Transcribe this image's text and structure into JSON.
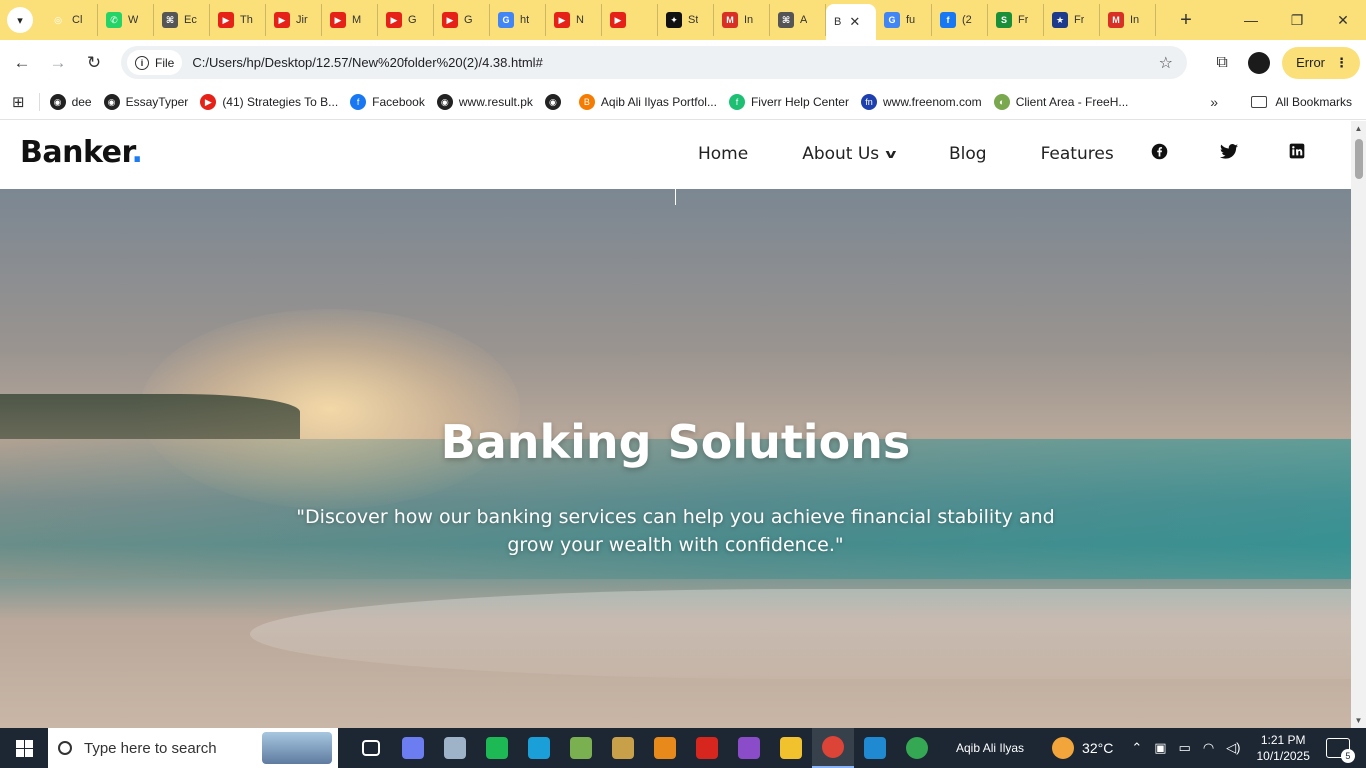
{
  "browser": {
    "tabs": [
      {
        "title": "Cl",
        "color": "#fbe07a",
        "glyph": "◎"
      },
      {
        "title": "W",
        "color": "#25d366",
        "glyph": "✆"
      },
      {
        "title": "Ec",
        "color": "#555",
        "glyph": "⌘"
      },
      {
        "title": "Th",
        "color": "#e62117",
        "glyph": "▶"
      },
      {
        "title": "Jir",
        "color": "#e62117",
        "glyph": "▶"
      },
      {
        "title": "M",
        "color": "#e62117",
        "glyph": "▶"
      },
      {
        "title": "G",
        "color": "#e62117",
        "glyph": "▶"
      },
      {
        "title": "G",
        "color": "#e62117",
        "glyph": "▶"
      },
      {
        "title": "ht",
        "color": "#4285f4",
        "glyph": "G"
      },
      {
        "title": "N",
        "color": "#e62117",
        "glyph": "▶"
      },
      {
        "title": "",
        "color": "#e62117",
        "glyph": "▶"
      },
      {
        "title": "St",
        "color": "#111",
        "glyph": "✦"
      },
      {
        "title": "In",
        "color": "#d93025",
        "glyph": "M"
      },
      {
        "title": "A",
        "color": "#555",
        "glyph": "⌘"
      }
    ],
    "active_tab": {
      "title": "B",
      "color": "#333",
      "glyph": "B"
    },
    "tabs_after": [
      {
        "title": "fu",
        "color": "#4285f4",
        "glyph": "G"
      },
      {
        "title": "(2",
        "color": "#1877f2",
        "glyph": "f"
      },
      {
        "title": "Fr",
        "color": "#1a8f3a",
        "glyph": "S"
      },
      {
        "title": "Fr",
        "color": "#1e3a8a",
        "glyph": "★"
      },
      {
        "title": "In",
        "color": "#d93025",
        "glyph": "M"
      }
    ],
    "chip_label": "File",
    "url": "C:/Users/hp/Desktop/12.57/New%20folder%20(2)/4.38.html#",
    "error_label": "Error",
    "bookmarks": [
      {
        "label": "dee",
        "color": "#222",
        "glyph": "◉"
      },
      {
        "label": "EssayTyper",
        "color": "#222",
        "glyph": "◉"
      },
      {
        "label": "(41) Strategies To B...",
        "color": "#e62117",
        "glyph": "▶"
      },
      {
        "label": "Facebook",
        "color": "#1877f2",
        "glyph": "f"
      },
      {
        "label": "www.result.pk",
        "color": "#222",
        "glyph": "◉"
      },
      {
        "label": "",
        "color": "#222",
        "glyph": "◉"
      },
      {
        "label": "Aqib Ali Ilyas Portfol...",
        "color": "#f57c00",
        "glyph": "B"
      },
      {
        "label": "Fiverr Help Center",
        "color": "#1dbf73",
        "glyph": "f"
      },
      {
        "label": "www.freenom.com",
        "color": "#1e40af",
        "glyph": "fn"
      },
      {
        "label": "Client Area - FreeH...",
        "color": "#7aa84f",
        "glyph": "◐"
      }
    ],
    "all_bookmarks": "All Bookmarks"
  },
  "site": {
    "brand_name": "Banker",
    "brand_dot": ".",
    "nav": {
      "home": "Home",
      "about": "About Us",
      "blog": "Blog",
      "features": "Features"
    },
    "hero": {
      "title": "Banking Solutions",
      "subtitle": "\"Discover how our banking services can help you achieve financial stability and grow your wealth with confidence.\""
    },
    "accent_color": "#1e7cf2"
  },
  "taskbar": {
    "search_placeholder": "Type here to search",
    "user_name": "Aqib Ali Ilyas",
    "temperature": "32°C",
    "time": "1:21 PM",
    "date": "10/1/2025",
    "notification_count": "5",
    "apps": [
      {
        "name": "task-view-icon",
        "color": "#1c2733"
      },
      {
        "name": "copilot-icon",
        "color": "#6b7df0"
      },
      {
        "name": "photo-viewer-icon",
        "color": "#9fb3c8"
      },
      {
        "name": "inkscape-icon",
        "color": "#1db954"
      },
      {
        "name": "edge-icon",
        "color": "#1a9fd8"
      },
      {
        "name": "notepad-icon",
        "color": "#7ab04f"
      },
      {
        "name": "paint-icon",
        "color": "#c8a04a"
      },
      {
        "name": "firefox-icon",
        "color": "#e8891b"
      },
      {
        "name": "acrobat-icon",
        "color": "#d7261e"
      },
      {
        "name": "visual-studio-icon",
        "color": "#8a4cc9"
      },
      {
        "name": "file-explorer-icon",
        "color": "#f2c12e"
      },
      {
        "name": "chrome-icon",
        "color": "#db4437"
      },
      {
        "name": "vscode-icon",
        "color": "#1f8ad2"
      },
      {
        "name": "chrome-profile-icon",
        "color": "#34a853"
      }
    ]
  }
}
